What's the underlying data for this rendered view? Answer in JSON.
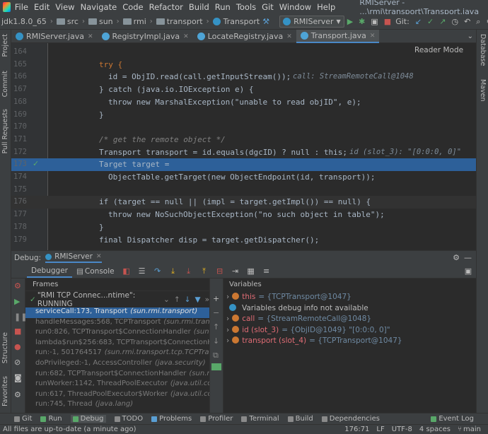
{
  "menubar": {
    "items": [
      "File",
      "Edit",
      "View",
      "Navigate",
      "Code",
      "Refactor",
      "Build",
      "Run",
      "Tools",
      "Git",
      "Window",
      "Help"
    ],
    "title": "RMIServer - ...\\rmi\\transport\\Transport.java"
  },
  "navbar": {
    "crumbs": [
      "jdk1.8.0_65",
      "src",
      "sun",
      "rmi",
      "transport",
      "Transport"
    ],
    "run_config": "RMIServer",
    "git_label": "Git:"
  },
  "tabs": [
    {
      "label": "RMIServer.java",
      "active": false
    },
    {
      "label": "RegistryImpl.java",
      "active": false
    },
    {
      "label": "LocateRegistry.java",
      "active": false
    },
    {
      "label": "Transport.java",
      "active": true
    }
  ],
  "editor": {
    "reader_mode": "Reader Mode",
    "lines": [
      {
        "n": "164",
        "text": ""
      },
      {
        "n": "165",
        "text": "try {"
      },
      {
        "n": "166",
        "text": "id = ObjID.read(call.getInputStream());",
        "hint": "call: StreamRemoteCall@1048"
      },
      {
        "n": "167",
        "text": "} catch (java.io.IOException e) {"
      },
      {
        "n": "168",
        "text": "throw new MarshalException(\"unable to read objID\", e);"
      },
      {
        "n": "169",
        "text": "}"
      },
      {
        "n": "170",
        "text": ""
      },
      {
        "n": "171",
        "text": "/* get the remote object */"
      },
      {
        "n": "172",
        "text": "Transport transport = id.equals(dgcID) ? null : this;",
        "hint": "id (slot_3): \"[0:0:0, 0]\""
      },
      {
        "n": "173",
        "text": "Target target ="
      },
      {
        "n": "174",
        "text": "ObjectTable.getTarget(new ObjectEndpoint(id, transport));"
      },
      {
        "n": "175",
        "text": ""
      },
      {
        "n": "176",
        "text": "if (target == null || (impl = target.getImpl()) == null) {"
      },
      {
        "n": "177",
        "text": "throw new NoSuchObjectException(\"no such object in table\");"
      },
      {
        "n": "178",
        "text": "}"
      },
      {
        "n": "179",
        "text": "final Dispatcher disp = target.getDispatcher();"
      }
    ]
  },
  "debug": {
    "label": "Debug:",
    "session": "RMIServer",
    "tabs": [
      "Debugger",
      "Console"
    ],
    "frames_header": "Frames",
    "thread": "\"RMI TCP Connec...ntime\": RUNNING",
    "frames": [
      {
        "m": "serviceCall:173, Transport",
        "p": "(sun.rmi.transport)"
      },
      {
        "m": "handleMessages:568, TCPTransport",
        "p": "(sun.rmi.transport.tcp)"
      },
      {
        "m": "run0:826, TCPTransport$ConnectionHandler",
        "p": "(sun.rmi.trans"
      },
      {
        "m": "lambda$run$256:683, TCPTransport$ConnectionHandler",
        "p": ""
      },
      {
        "m": "run:-1, 501764517",
        "p": "(sun.rmi.transport.tcp.TCPTransport$C"
      },
      {
        "m": "doPrivileged:-1, AccessController",
        "p": "(java.security)"
      },
      {
        "m": "run:682, TCPTransport$ConnectionHandler",
        "p": "(sun.rmi.trans"
      },
      {
        "m": "runWorker:1142, ThreadPoolExecutor",
        "p": "(java.util.concurren"
      },
      {
        "m": "run:617, ThreadPoolExecutor$Worker",
        "p": "(java.util.concurren"
      },
      {
        "m": "run:745, Thread",
        "p": "(java.lang)"
      }
    ],
    "variables_header": "Variables",
    "variables": [
      {
        "name": "this",
        "value": "= {TCPTransport@1047}",
        "icon": "field"
      },
      {
        "name": "",
        "value": "Variables debug info not available",
        "icon": "info"
      },
      {
        "name": "call",
        "value": "= {StreamRemoteCall@1048}",
        "icon": "field"
      },
      {
        "name": "id (slot_3)",
        "value": "= {ObjID@1049} \"[0:0:0, 0]\"",
        "icon": "field"
      },
      {
        "name": "transport (slot_4)",
        "value": "= {TCPTransport@1047}",
        "icon": "field"
      }
    ]
  },
  "left_stripe": [
    "Project",
    "Commit",
    "Pull Requests",
    "Structure",
    "Favorites"
  ],
  "right_stripe": [
    "Database",
    "Maven"
  ],
  "bottom_tools": [
    "Git",
    "Run",
    "Debug",
    "TODO",
    "Problems",
    "Profiler",
    "Terminal",
    "Build",
    "Dependencies",
    "Event Log"
  ],
  "status": {
    "message": "All files are up-to-date (a minute ago)",
    "position": "176:71",
    "line_sep": "LF",
    "encoding": "UTF-8",
    "indent": "4 spaces",
    "branch": "main"
  }
}
